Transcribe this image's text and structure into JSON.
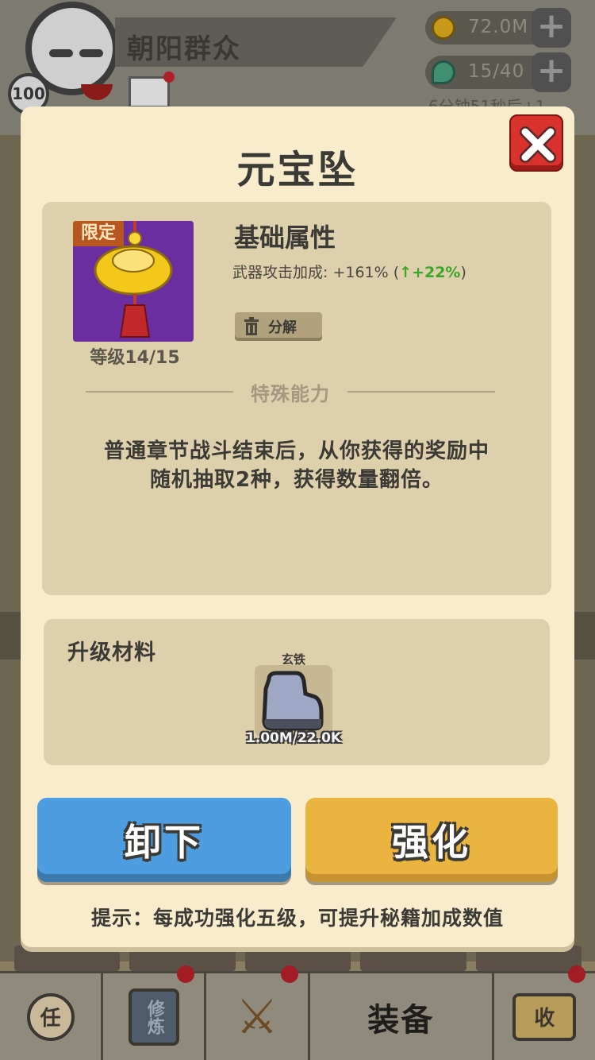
{
  "player": {
    "name": "朝阳群众",
    "level": "100"
  },
  "resources": {
    "coins": "72.0M",
    "gems": "15/40",
    "timer": "6分钟51秒后+1"
  },
  "modal": {
    "title": "元宝坠",
    "item": {
      "limited_tag": "限定",
      "level": "等级14/15"
    },
    "base_attr_title": "基础属性",
    "stat": {
      "label": "武器攻击加成: +161% (",
      "arrow": "↑",
      "bonus": "+22%",
      "close": ")"
    },
    "decompose_label": "分解",
    "special_title": "特殊能力",
    "special_desc_line1": "普通章节战斗结束后，从你获得的奖励中",
    "special_desc_line2": "随机抽取2种，获得数量翻倍。",
    "materials": {
      "title": "升级材料",
      "item_name": "玄铁",
      "amount": "1.00M/22.0K"
    },
    "buttons": {
      "unequip": "卸下",
      "enhance": "强化"
    },
    "hint": "提示：每成功强化五级，可提升秘籍加成数值"
  },
  "bottom_nav": {
    "task": "任",
    "train": "修炼",
    "equip": "装备",
    "collect": "收"
  },
  "colors": {
    "modal_bg": "#f8eccc",
    "panel_bg": "#ded0ad",
    "unequip_blue": "#4d9de0",
    "enhance_gold": "#eab440",
    "close_red": "#d9322c",
    "bonus_green": "#3aa62a"
  },
  "icons": {
    "close": "close-x-icon",
    "decompose": "trash-icon",
    "item": "gold-ingot-pendant-icon",
    "material": "iron-ore-icon"
  }
}
